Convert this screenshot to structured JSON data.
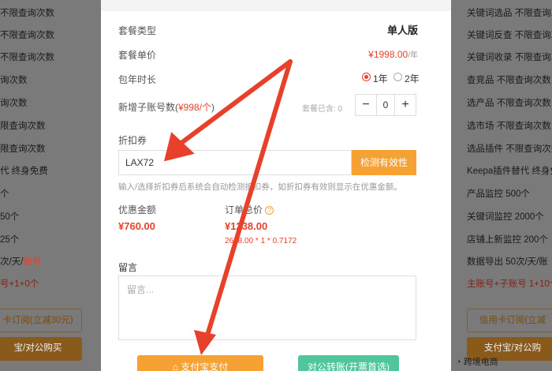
{
  "background": {
    "left_lines": [
      "不限查询次数",
      "不限查询次数",
      "不限查询次数",
      "询次数",
      "询次数",
      "限查询次数",
      "限查询次数",
      "代 终身免费",
      "个",
      "50个",
      "25个",
      "次/天/",
      "号+1+0个"
    ],
    "left_line_red_part": "账号",
    "left_outline_button": "卡订阅(立减30元)",
    "left_filled_button": "宝/对公购买",
    "right_lines": [
      "关键词选品 不限查询次",
      "关键词反查 不限查询次",
      "关键词收录 不限查询次",
      "查竞品 不限查询次数",
      "选产品 不限查询次数",
      "选市场 不限查询次数",
      "选品插件 不限查询次数",
      "Keepa插件替代 终身免",
      "产品监控 500个",
      "关键词监控 2000个",
      "店铺上新监控 200个",
      "数据导出 50次/天/账"
    ],
    "right_red_line": "主账号+子账号 1+10个",
    "right_outline_button": "信用卡订阅(立减",
    "right_filled_button": "支付宝/对公购"
  },
  "modal": {
    "package_type_label": "套餐类型",
    "package_type_value": "单人版",
    "unit_price_label": "套餐单价",
    "unit_price_value": "¥1998.00",
    "unit_price_suffix": "/年",
    "duration_label": "包年时长",
    "duration_options": [
      "1年",
      "2年"
    ],
    "duration_selected": "1年",
    "sub_accounts_label": "新增子账号数(",
    "sub_accounts_price": "¥998/个",
    "sub_accounts_close": ")",
    "existing_label": "套餐已含: 0",
    "stepper_minus": "−",
    "stepper_value": "0",
    "stepper_plus": "+",
    "coupon_label": "折扣券",
    "coupon_value": "LAX72",
    "check_button": "检测有效性",
    "coupon_hint": "输入/选择折扣券后系统会自动检测折扣券，如折扣券有效则显示在优惠金额。",
    "discount_label": "优惠金额",
    "discount_value": "¥760.00",
    "total_label": "订单总价",
    "total_value": "¥1238.00",
    "total_formula": "2688.00 * 1 * 0.7172",
    "message_label": "留言",
    "message_placeholder": "留言...",
    "alipay_button": "支付宝支付",
    "transfer_button": "对公转账(开票首选)"
  },
  "watermark": "跨境电商",
  "colors": {
    "accent_red": "#e8412b",
    "orange": "#f5a133",
    "green": "#4fc79a",
    "arrow": "#e8412b"
  }
}
